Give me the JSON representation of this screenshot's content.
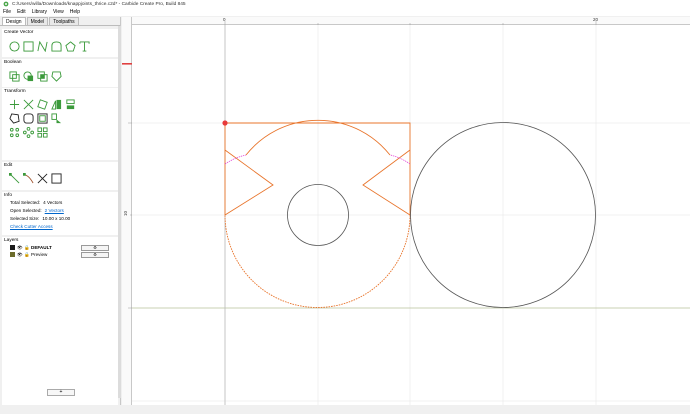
{
  "window": {
    "title": "C:/Users/willa/Downloads/knappjoints_thrice.c2d* - Carbide Create Pro, Build 845"
  },
  "menu": [
    "File",
    "Edit",
    "Library",
    "View",
    "Help"
  ],
  "tabs": [
    "Design",
    "Model",
    "Toolpaths"
  ],
  "sections": {
    "create_vector": "Create Vector",
    "boolean": "Boolean",
    "transform": "Transform",
    "edit": "Edit",
    "info": "Info",
    "layers": "Layers"
  },
  "info": {
    "total_selected_label": "Total Selected:",
    "total_selected_value": "4 Vectors",
    "open_selected_label": "Open Selected:",
    "open_selected_value": "2 Vectors",
    "selected_size_label": "Selected Size:",
    "selected_size_value": "10.00 x 10.00",
    "check_cutter_access": "Check Cutter Access"
  },
  "layers": [
    {
      "name": "DEFAULT",
      "color": "#1a1a1a"
    },
    {
      "name": "Preview",
      "color": "#6b6b2a"
    }
  ],
  "ruler": {
    "h_labels": [
      "0",
      "20"
    ],
    "v_labels": [
      "10"
    ]
  },
  "bottom_button": "+",
  "colors": {
    "selected_path": "#e8742b",
    "unselected_path": "#555555",
    "grid": "#e6e6e6",
    "x_axis": "#b8c29a",
    "y_axis": "#b8b8b8",
    "fillet": "#e34fd8",
    "icon_green": "#3b9a3b"
  }
}
